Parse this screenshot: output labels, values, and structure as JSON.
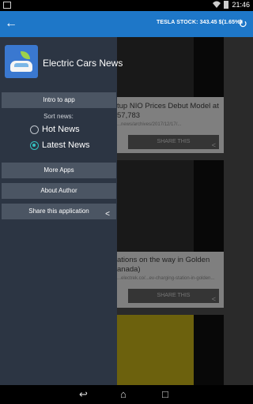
{
  "status": {
    "time": "21:46"
  },
  "appbar": {
    "back_icon": "arrow-left-icon",
    "ticker": "TESLA STOCK: 343.45 $(1.65%)",
    "refresh_icon": "refresh-icon"
  },
  "content": {
    "cards": [
      {
        "title_line1": "tup NIO Prices Debut Model at",
        "title_line2": "57,783",
        "url": "...news/archives/2017/12/17/...",
        "share_label": "SHARE THIS"
      },
      {
        "title_line1": "ations on the way in Golden",
        "title_line2": "anada)",
        "url": "...electrek.co/...ev-charging-station-in-golden...",
        "share_label": "SHARE THIS"
      }
    ]
  },
  "drawer": {
    "app_name": "Electric Cars News",
    "intro": "Intro to app",
    "sort_label": "Sort news:",
    "hot": "Hot News",
    "latest": "Latest News",
    "selected": "latest",
    "more_apps": "More Apps",
    "about": "About Author",
    "share_app": "Share this application"
  },
  "navbar": {
    "back": "back-icon",
    "home": "home-icon",
    "recents": "recents-icon"
  },
  "colors": {
    "appbar": "#1e77c8",
    "drawer": "#2c3543",
    "accent": "#35c1c1"
  }
}
